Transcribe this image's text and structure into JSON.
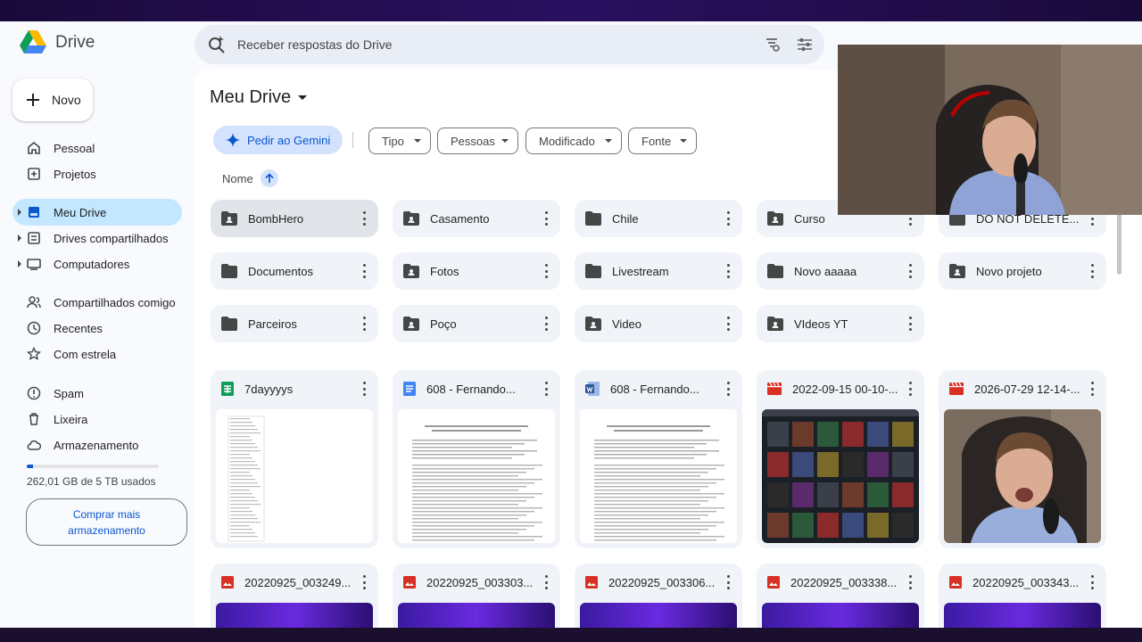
{
  "app": {
    "logo_text": "Drive",
    "search_placeholder": "Receber respostas do Drive"
  },
  "sidebar": {
    "new_label": "Novo",
    "items": [
      {
        "label": "Pessoal",
        "icon": "home-icon"
      },
      {
        "label": "Projetos",
        "icon": "workspace-icon"
      },
      {
        "label": "Meu Drive",
        "icon": "my-drive-icon",
        "active": true
      },
      {
        "label": "Drives compartilhados",
        "icon": "shared-drives-icon"
      },
      {
        "label": "Computadores",
        "icon": "computer-icon"
      },
      {
        "label": "Compartilhados comigo",
        "icon": "people-icon"
      },
      {
        "label": "Recentes",
        "icon": "clock-icon"
      },
      {
        "label": "Com estrela",
        "icon": "star-icon"
      },
      {
        "label": "Spam",
        "icon": "spam-icon"
      },
      {
        "label": "Lixeira",
        "icon": "trash-icon"
      },
      {
        "label": "Armazenamento",
        "icon": "cloud-icon"
      }
    ],
    "storage_text": "262,01 GB de 5 TB usados",
    "storage_fraction": 0.05,
    "buy_label": "Comprar mais armazenamento"
  },
  "main": {
    "title": "Meu Drive",
    "gemini_label": "Pedir ao Gemini",
    "filters": [
      "Tipo",
      "Pessoas",
      "Modificado",
      "Fonte"
    ],
    "sort_label": "Nome",
    "folders": [
      {
        "name": "BombHero",
        "shared": true
      },
      {
        "name": "Casamento",
        "shared": true
      },
      {
        "name": "Chile",
        "shared": false
      },
      {
        "name": "Curso",
        "shared": true
      },
      {
        "name": "DO NOT DELETE...",
        "shared": false
      },
      {
        "name": "Documentos",
        "shared": false
      },
      {
        "name": "Fotos",
        "shared": true
      },
      {
        "name": "Livestream",
        "shared": false
      },
      {
        "name": "Novo aaaaa",
        "shared": false
      },
      {
        "name": "Novo projeto",
        "shared": true
      },
      {
        "name": "Parceiros",
        "shared": false
      },
      {
        "name": "Poço",
        "shared": true
      },
      {
        "name": "Video",
        "shared": true
      },
      {
        "name": "VIdeos YT",
        "shared": true
      }
    ],
    "files": [
      {
        "name": "7dayyyys",
        "type": "sheets"
      },
      {
        "name": "608 - Fernando...",
        "type": "docs"
      },
      {
        "name": "608 - Fernando...",
        "type": "word"
      },
      {
        "name": "2022-09-15 00-10-...",
        "type": "video"
      },
      {
        "name": "2026-07-29 12-14-...",
        "type": "video"
      },
      {
        "name": "20220925_003249....",
        "type": "image"
      },
      {
        "name": "20220925_003303....",
        "type": "image"
      },
      {
        "name": "20220925_003306....",
        "type": "image"
      },
      {
        "name": "20220925_003338....",
        "type": "image"
      },
      {
        "name": "20220925_003343....",
        "type": "image"
      }
    ]
  },
  "colors": {
    "accent": "#0b57d0",
    "active_nav": "#c2e7ff",
    "card_bg": "#f0f4f9"
  }
}
